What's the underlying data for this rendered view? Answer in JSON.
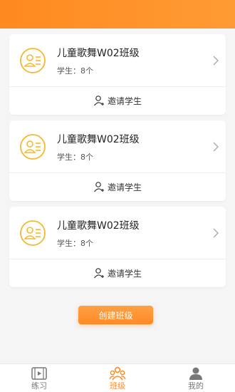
{
  "classes": [
    {
      "name": "儿童歌舞W02班级",
      "students": "学生：8个",
      "invite_label": "邀请学生"
    },
    {
      "name": "儿童歌舞W02班级",
      "students": "学生：8个",
      "invite_label": "邀请学生"
    },
    {
      "name": "儿童歌舞W02班级",
      "students": "学生：8个",
      "invite_label": "邀请学生"
    }
  ],
  "create_button": "创建班级",
  "tabs": [
    {
      "label": "练习",
      "icon": "video-icon",
      "active": false
    },
    {
      "label": "班级",
      "icon": "group-icon",
      "active": true
    },
    {
      "label": "我的",
      "icon": "user-icon",
      "active": false
    }
  ],
  "colors": {
    "accent": "#ff8a24",
    "icon_yellow": "#f5b82e"
  }
}
